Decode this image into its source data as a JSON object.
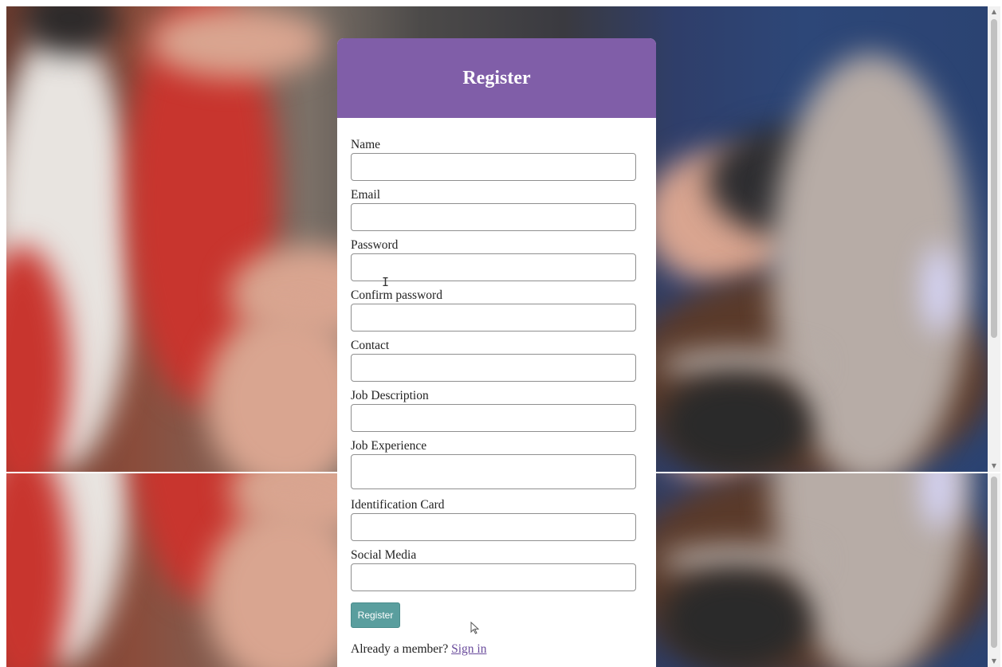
{
  "form": {
    "title": "Register",
    "fields": [
      {
        "label": "Name",
        "value": "",
        "placeholder": ""
      },
      {
        "label": "Email",
        "value": "",
        "placeholder": ""
      },
      {
        "label": "Password",
        "value": "",
        "placeholder": ""
      },
      {
        "label": "Confirm password",
        "value": "",
        "placeholder": ""
      },
      {
        "label": "Contact",
        "value": "",
        "placeholder": ""
      },
      {
        "label": "Job Description",
        "value": "",
        "placeholder": ""
      },
      {
        "label": "Job Experience",
        "value": "",
        "placeholder": ""
      },
      {
        "label": "Identification Card",
        "value": "",
        "placeholder": ""
      },
      {
        "label": "Social Media",
        "value": "",
        "placeholder": ""
      }
    ],
    "submit_label": "Register",
    "footer_text": "Already a member? ",
    "signin_label": "Sign in"
  },
  "colors": {
    "header": "#805ea8",
    "button": "#5a9e9e",
    "link": "#6a4c9c"
  },
  "icons": {
    "ibeam": "text-cursor-icon",
    "pointer": "mouse-pointer-icon"
  }
}
